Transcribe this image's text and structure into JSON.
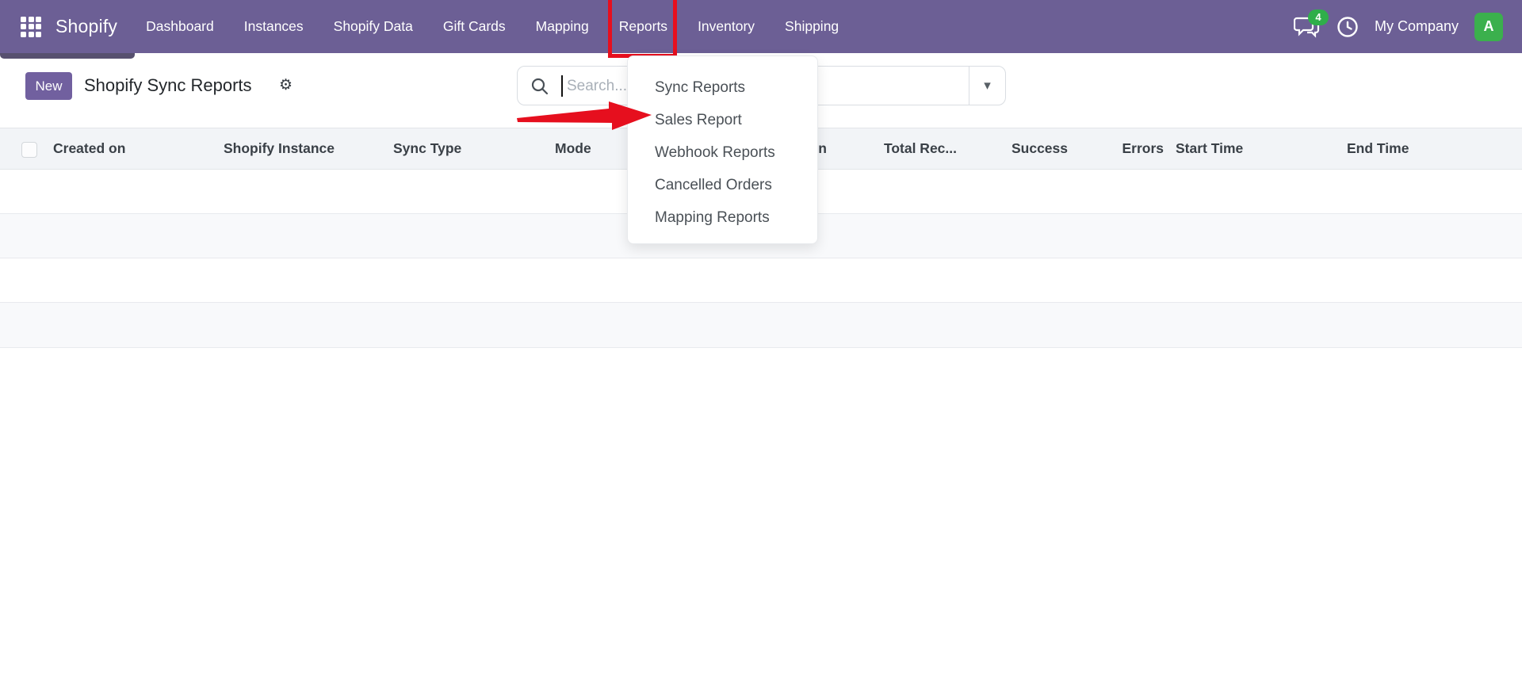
{
  "navbar": {
    "brand": "Shopify",
    "items": [
      "Dashboard",
      "Instances",
      "Shopify Data",
      "Gift Cards",
      "Mapping",
      "Reports",
      "Inventory",
      "Shipping"
    ],
    "highlighted_item": "Reports",
    "message_badge_count": "4",
    "company": "My Company",
    "avatar_letter": "A"
  },
  "control_panel": {
    "new_button_label": "New",
    "title": "Shopify Sync Reports",
    "gear_glyph": "⚙"
  },
  "search": {
    "placeholder": "Search...",
    "caret_glyph": "▾"
  },
  "reports_menu": {
    "items": [
      "Sync Reports",
      "Sales Report",
      "Webhook Reports",
      "Cancelled Orders",
      "Mapping Reports"
    ],
    "pointed_item": "Sales Report"
  },
  "annotations": {
    "color": "#e60f1e",
    "box_target": "Reports",
    "arrow_target": "Sales Report"
  },
  "table": {
    "columns": [
      "Created on",
      "Shopify Instance",
      "Sync Type",
      "Mode",
      "Operation",
      "Total Rec...",
      "Success",
      "Errors",
      "Start Time",
      "End Time"
    ],
    "rows": []
  },
  "icons": {
    "apps": "grid-3x3",
    "search": "magnifier",
    "messages": "chat-bubbles",
    "activities": "clock",
    "dropdown_toggle": "caret-down",
    "settings": "gear"
  },
  "colors": {
    "navbar_purple": "#6c5f95",
    "button_purple": "#71609f",
    "badge_green": "#2fae4a",
    "avatar_green": "#3bb04d",
    "annotation_red": "#e60f1e",
    "header_bg": "#f2f4f7",
    "row_stripe": "#f8f9fb"
  }
}
